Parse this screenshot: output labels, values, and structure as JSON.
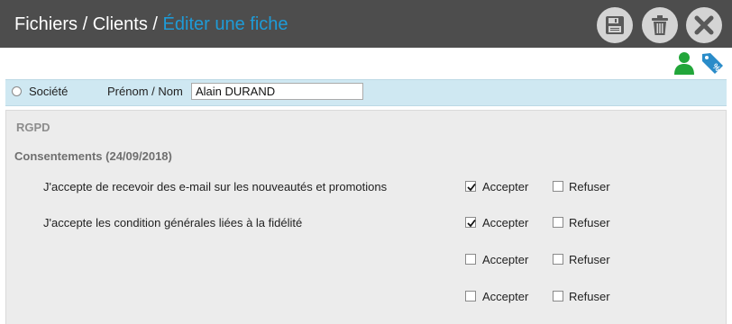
{
  "header": {
    "breadcrumb": [
      "Fichiers",
      "Clients"
    ],
    "separator": "/",
    "current": "Éditer une fiche",
    "current_color": "#1e9bd7",
    "background": "#4d4d4d",
    "buttons": [
      "save-icon",
      "trash-icon",
      "close-icon"
    ]
  },
  "toolbar_icons": [
    {
      "icon": "user-icon",
      "color": "#22a63a"
    },
    {
      "icon": "price-tag-icon",
      "color": "#2a8cc9"
    }
  ],
  "identity": {
    "company_label": "Société",
    "company_selected": false,
    "name_label": "Prénom / Nom",
    "name_value": "Alain DURAND"
  },
  "rgpd": {
    "title": "RGPD",
    "consents_title": "Consentements (24/09/2018)",
    "accept_label": "Accepter",
    "refuse_label": "Refuser",
    "rows": [
      {
        "text": "J'accepte de recevoir des e-mail sur les nouveautés et promotions",
        "accepted": true,
        "refused": false
      },
      {
        "text": "J'accepte les condition générales liées à la fidélité",
        "accepted": true,
        "refused": false
      },
      {
        "text": "",
        "accepted": false,
        "refused": false
      },
      {
        "text": "",
        "accepted": false,
        "refused": false
      }
    ]
  }
}
